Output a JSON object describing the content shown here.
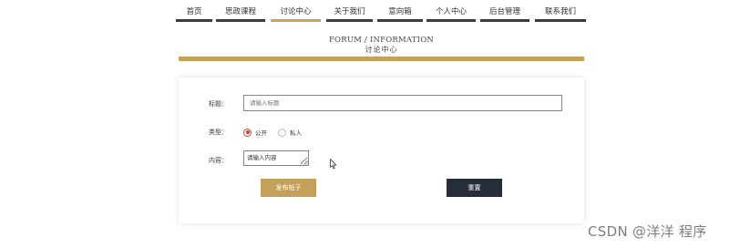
{
  "nav": {
    "items": [
      {
        "label": "首页"
      },
      {
        "label": "思政课程"
      },
      {
        "label": "讨论中心",
        "active": true
      },
      {
        "label": "关于我们"
      },
      {
        "label": "意向箱"
      },
      {
        "label": "个人中心"
      },
      {
        "label": "后台管理"
      },
      {
        "label": "联系我们"
      }
    ],
    "active_color": "#c7a45a",
    "inactive_color": "#3b3b3b"
  },
  "heading": {
    "english": "FORUM / INFORMATION",
    "chinese": "讨论中心"
  },
  "form": {
    "title_label": "标题：",
    "title_placeholder": "请输入标题",
    "type_label": "类型：",
    "type_options": [
      {
        "label": "公开",
        "checked": true
      },
      {
        "label": "私人",
        "checked": false
      }
    ],
    "content_label": "内容：",
    "content_value": "请输入内容",
    "submit_label": "发布帖子",
    "reset_label": "重置"
  },
  "watermark": "CSDN @洋洋 程序",
  "colors": {
    "accent_gold": "#c4a25a",
    "dark_button": "#272d38",
    "radio_checked": "#d5402b"
  },
  "icons": {
    "cursor": "mouse-pointer-icon"
  }
}
